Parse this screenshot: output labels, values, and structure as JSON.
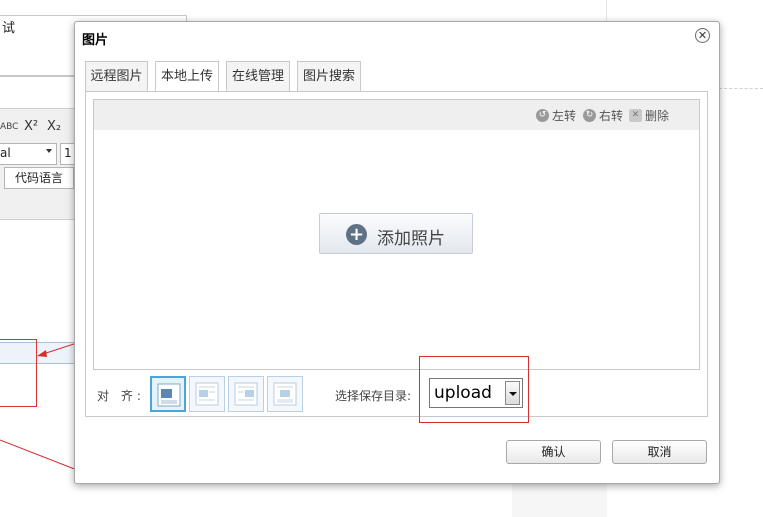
{
  "background": {
    "top_text": "试",
    "toolbar": {
      "abc": "ABC",
      "superscript": "X²",
      "subscript": "X₂"
    },
    "font_select": "al",
    "size_select": "1",
    "code_button": "代码语言"
  },
  "dialog": {
    "title": "图片",
    "close_symbol": "✕",
    "tabs": [
      {
        "label": "远程图片"
      },
      {
        "label": "本地上传"
      },
      {
        "label": "在线管理"
      },
      {
        "label": "图片搜索"
      }
    ],
    "active_tab": "本地上传",
    "toolbar": {
      "rotate_left": "左转",
      "rotate_right": "右转",
      "delete": "删除"
    },
    "add_photo": "添加照片",
    "align_label": "对 齐:",
    "dir_label": "选择保存目录:",
    "dir_value": "upload",
    "confirm": "确认",
    "cancel": "取消"
  },
  "colors": {
    "highlight_red": "#d42f2f",
    "selected_align_border": "#4aa6d8"
  }
}
